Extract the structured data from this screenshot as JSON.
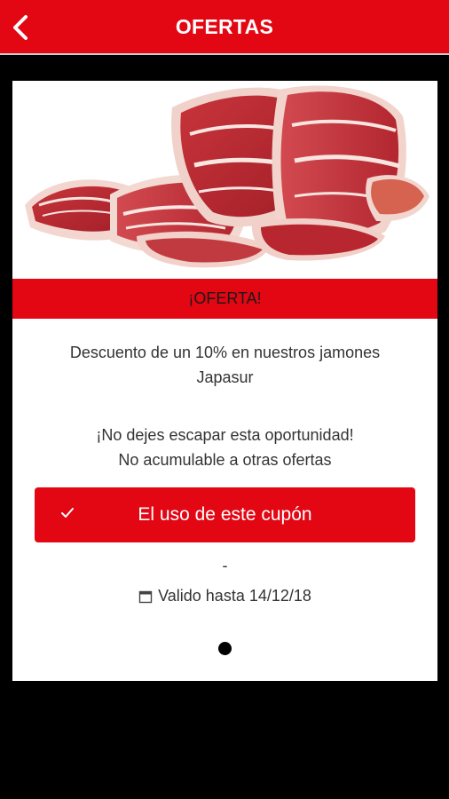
{
  "app_bar": {
    "title": "OFERTAS",
    "back_icon": "chevron-left-icon",
    "color": "#e30613"
  },
  "offer": {
    "image": "sliced-iberian-ham-photo",
    "banner_label": "¡OFERTA!",
    "description_line1": "Descuento de un 10% en nuestros jamones",
    "description_line2": "Japasur",
    "note_line1": "¡No dejes escapar esta oportunidad!",
    "note_line2": "No acumulable a otras ofertas",
    "coupon_button_label": "El uso de este cupón",
    "coupon_icon": "check-icon",
    "separator": "-",
    "valid_icon": "calendar-icon",
    "valid_until": "Valido hasta 14/12/18"
  },
  "pager": {
    "current_page": 1,
    "total_pages": 1
  }
}
